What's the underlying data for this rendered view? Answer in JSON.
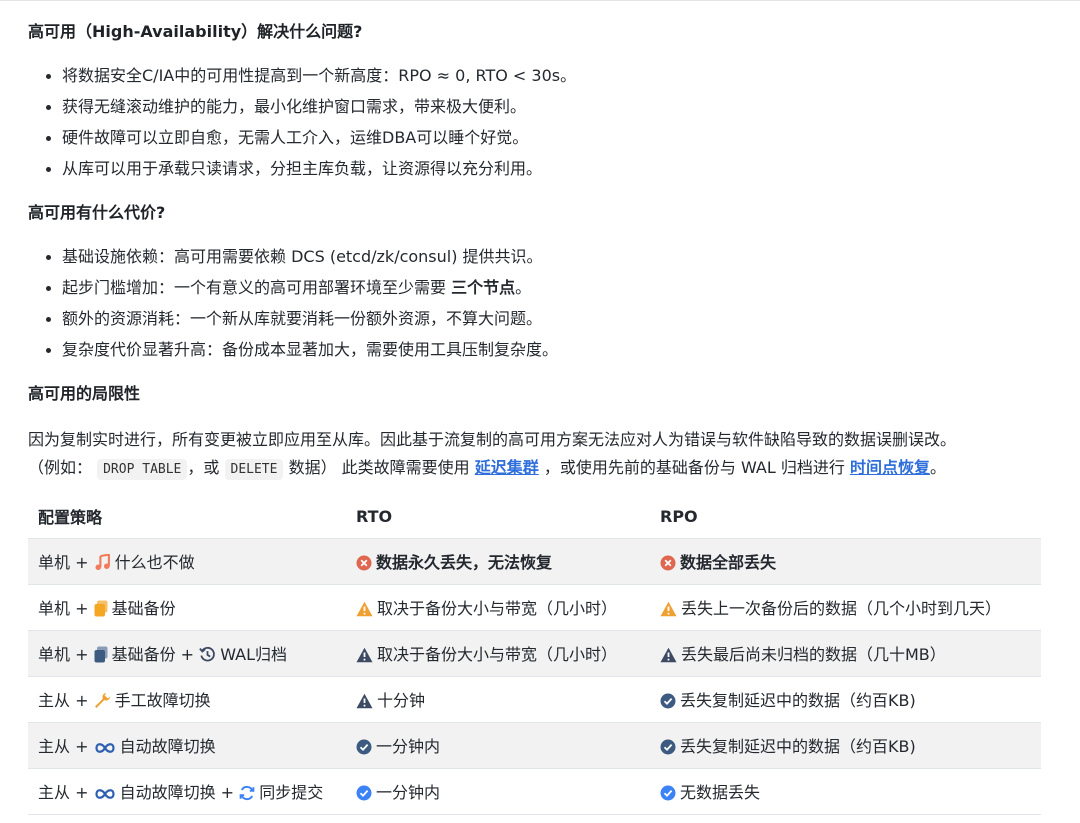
{
  "sections": {
    "s1_title": "高可用（High-Availability）解决什么问题?",
    "s1_items": [
      "将数据安全C/IA中的可用性提高到一个新高度：RPO ≈ 0, RTO < 30s。",
      "获得无缝滚动维护的能力，最小化维护窗口需求，带来极大便利。",
      "硬件故障可以立即自愈，无需人工介入，运维DBA可以睡个好觉。",
      "从库可以用于承载只读请求，分担主库负载，让资源得以充分利用。"
    ],
    "s2_title": "高可用有什么代价?",
    "s2_items": [
      "基础设施依赖：高可用需要依赖 DCS (etcd/zk/consul) 提供共识。",
      "起步门槛增加：一个有意义的高可用部署环境至少需要 ",
      "额外的资源消耗：一个新从库就要消耗一份额外资源，不算大问题。",
      "复杂度代价显著升高：备份成本显著加大，需要使用工具压制复杂度。"
    ],
    "s2_item2_bold": "三个节点",
    "s2_item2_tail": "。",
    "s3_title": "高可用的局限性",
    "s3_para_line1": "因为复制实时进行，所有变更被立即应用至从库。因此基于流复制的高可用方案无法应对人为错误与软件缺陷导致的数据误删误改。",
    "s3_p2_a": "（例如：",
    "s3_code1": "DROP TABLE",
    "s3_p2_b": "，或",
    "s3_code2": "DELETE",
    "s3_p2_c": "数据） 此类故障需要使用",
    "s3_link1": "延迟集群",
    "s3_p2_d": "，或使用先前的基础备份与 WAL 归档进行",
    "s3_link2": "时间点恢复",
    "s3_p2_e": "。"
  },
  "table": {
    "headers": [
      "配置策略",
      "RTO",
      "RPO"
    ],
    "rows": [
      {
        "prefix": "单机 +",
        "icon1": "music-note-icon",
        "label1": "什么也不做",
        "rto_icon": "error-circle-icon",
        "rto": "数据永久丢失，无法恢复",
        "rpo_icon": "error-circle-icon",
        "rpo": "数据全部丢失"
      },
      {
        "prefix": "单机 +",
        "icon1": "clipboard-icon",
        "label1": "基础备份",
        "rto_icon": "warning-triangle-icon",
        "rto": "取决于备份大小与带宽（几小时）",
        "rpo_icon": "warning-triangle-icon",
        "rpo": "丢失上一次备份后的数据（几个小时到几天）"
      },
      {
        "prefix": "单机 +",
        "icon1": "copy-icon",
        "label1": "基础备份 +",
        "icon2": "history-icon",
        "label2": "WAL归档",
        "rto_icon": "alert-triangle-icon",
        "rto": "取决于备份大小与带宽（几小时）",
        "rpo_icon": "alert-triangle-icon",
        "rpo": "丢失最后尚未归档的数据（几十MB）"
      },
      {
        "prefix": "主从 +",
        "icon1": "wrench-icon",
        "label1": "手工故障切换",
        "rto_icon": "alert-triangle-icon",
        "rto": "十分钟",
        "rpo_icon": "check-circle-icon",
        "rpo": "丢失复制延迟中的数据（约百KB)"
      },
      {
        "prefix": "主从 +",
        "icon1": "infinity-icon",
        "label1": "自动故障切换",
        "rto_icon": "check-circle-icon",
        "rto": "一分钟内",
        "rpo_icon": "check-circle-icon",
        "rpo": "丢失复制延迟中的数据（约百KB)"
      },
      {
        "prefix": "主从 +",
        "icon1": "infinity-icon",
        "label1": "自动故障切换 +",
        "icon2": "sync-icon",
        "label2": "同步提交",
        "rto_icon": "check-badge-icon",
        "rto": "一分钟内",
        "rpo_icon": "check-badge-icon",
        "rpo": "无数据丢失"
      }
    ]
  },
  "colors": {
    "error": "#e0674f",
    "warning": "#f0a030",
    "alert": "#3d4a63",
    "check_dark": "#3d5a80",
    "check_blue": "#3b82f6",
    "music": "#f07c5a",
    "clipboard": "#f5a623",
    "wrench": "#f0a030",
    "infinity": "#2f5fb0",
    "sync": "#3b82f6",
    "link": "#2f6fdc"
  }
}
